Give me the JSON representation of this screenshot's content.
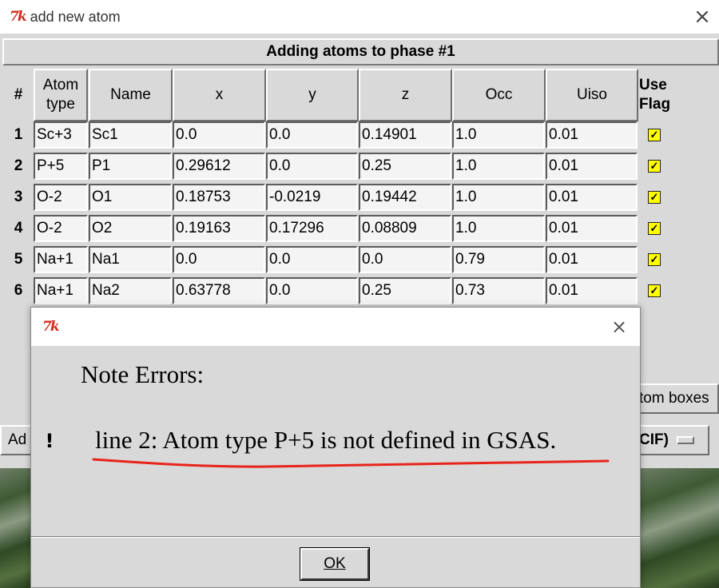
{
  "window": {
    "title": "add new atom",
    "logo": "7k"
  },
  "banner": "Adding atoms to phase #1",
  "table": {
    "headers": {
      "num": "#",
      "atom_type_1": "Atom",
      "atom_type_2": "type",
      "name": "Name",
      "x": "x",
      "y": "y",
      "z": "z",
      "occ": "Occ",
      "uiso": "Uiso",
      "use_flag_1": "Use",
      "use_flag_2": "Flag"
    },
    "rows": [
      {
        "num": "1",
        "type": "Sc+3",
        "name": "Sc1",
        "x": "0.0",
        "y": "0.0",
        "z": "0.14901",
        "occ": "1.0",
        "uiso": "0.01",
        "flag": true
      },
      {
        "num": "2",
        "type": "P+5",
        "name": "P1",
        "x": "0.29612",
        "y": "0.0",
        "z": "0.25",
        "occ": "1.0",
        "uiso": "0.01",
        "flag": true
      },
      {
        "num": "3",
        "type": "O-2",
        "name": "O1",
        "x": "0.18753",
        "y": "-0.0219",
        "z": "0.19442",
        "occ": "1.0",
        "uiso": "0.01",
        "flag": true
      },
      {
        "num": "4",
        "type": "O-2",
        "name": "O2",
        "x": "0.19163",
        "y": "0.17296",
        "z": "0.08809",
        "occ": "1.0",
        "uiso": "0.01",
        "flag": true
      },
      {
        "num": "5",
        "type": "Na+1",
        "name": "Na1",
        "x": "0.0",
        "y": "0.0",
        "z": "0.0",
        "occ": "0.79",
        "uiso": "0.01",
        "flag": true
      },
      {
        "num": "6",
        "type": "Na+1",
        "name": "Na2",
        "x": "0.63778",
        "y": "0.0",
        "z": "0.25",
        "occ": "0.73",
        "uiso": "0.01",
        "flag": true
      }
    ]
  },
  "background": {
    "atom_boxes_fragment": "tom boxes",
    "add_fragment": "Ad",
    "cif_fragment": "CIF)"
  },
  "dialog": {
    "logo": "7k",
    "heading": "Note Errors:",
    "message": "line 2: Atom type P+5 is not defined in GSAS.",
    "ok_label": "OK",
    "icon": "warning-icon",
    "underline_color": "#e8231b"
  },
  "colors": {
    "flag_fill": "#ffff00",
    "logo": "#d32a1e"
  }
}
